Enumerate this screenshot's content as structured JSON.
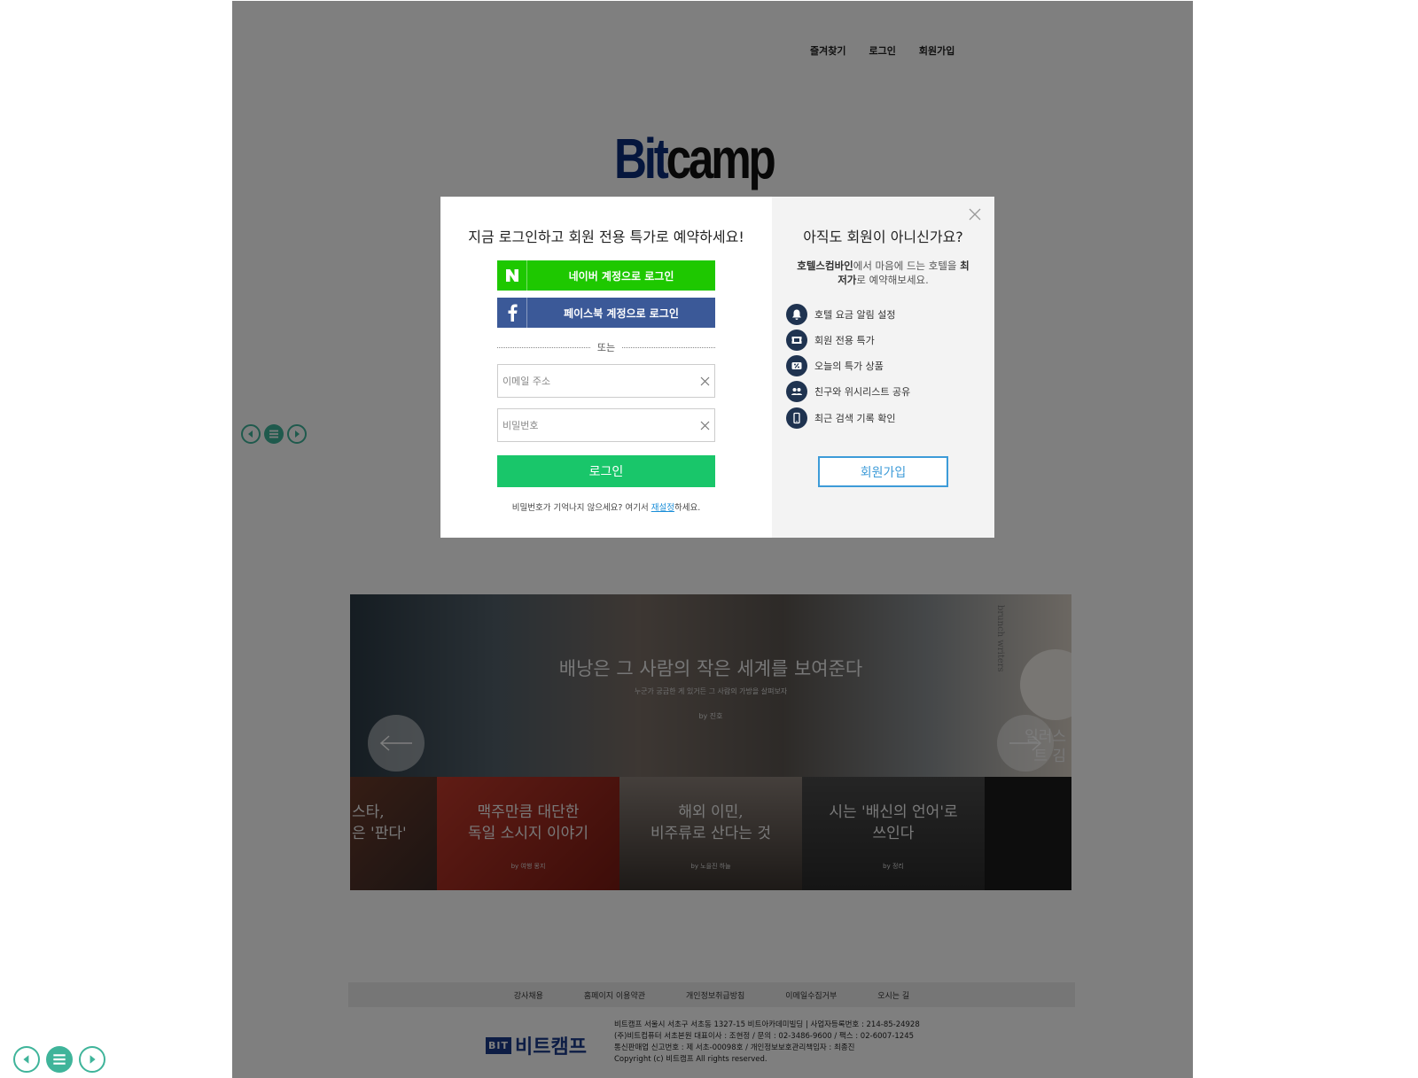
{
  "topnav": {
    "favorites": "즐겨찾기",
    "login": "로그인",
    "signup": "회원가입"
  },
  "logo": {
    "part1": "Bit",
    "part2": "camp"
  },
  "banner": {
    "headline": "배낭은 그 사람의 작은 세계를 보여준다",
    "subline": "누군가 궁금한 게 있거든 그 사람의 가방을 살펴보자",
    "byline": "by 진호",
    "side_text": "brunch writers",
    "right_peek_title": "일러스트 김",
    "tiles": [
      {
        "title": "스타,\n은 '판다'",
        "by": ""
      },
      {
        "title": "맥주만큼 대단한\n독일 소시지 이야기",
        "by": "by 여행 몽지"
      },
      {
        "title": "해외 이민,\n비주류로 산다는 것",
        "by": "by 노을진 하늘"
      },
      {
        "title": "시는 '배신의 언어'로\n쓰인다",
        "by": "by 정리"
      }
    ]
  },
  "footer": {
    "links": [
      "강사채용",
      "홈페이지 이용약관",
      "개인정보취급방침",
      "이메일수집거부",
      "오시는 길"
    ],
    "brand_mark": "BIT",
    "brand_name": "비트캠프",
    "info": [
      "비트캠프 서울시 서초구 서초동 1327-15 비트아카데미빌딩 | 사업자등록번호 : 214-85-24928",
      "(주)비트컴퓨터 서초본원 대표이사 : 조현정 / 문의 : 02-3486-9600 / 팩스 : 02-6007-1245",
      "통신판매업 신고번호 : 제 서초-00098호 / 개인정보보호관리책임자 : 최종진",
      "Copyright (c) 비트캠프 All rights reserved."
    ]
  },
  "modal": {
    "left_title": "지금 로그인하고 회원 전용 특가로 예약하세요!",
    "naver_label": "네이버 계정으로 로그인",
    "facebook_label": "페이스북 계정으로 로그인",
    "divider_text": "또는",
    "email_placeholder": "이메일 주소",
    "password_placeholder": "비밀번호",
    "login_button": "로그인",
    "forgot_prefix": "비밀번호가 기억나지 않으세요? 여기서 ",
    "forgot_link": "재설정",
    "forgot_suffix": "하세요.",
    "right_title": "아직도 회원이 아니신가요?",
    "right_desc": {
      "brand": "호텔스컴바인",
      "mid": "에서 마음에 드는 호텔을 ",
      "emph": "최저가",
      "end": "로 예약해보세요."
    },
    "benefits": [
      {
        "icon": "bell-icon",
        "label": "호텔 요금 알림 설정"
      },
      {
        "icon": "ticket-icon",
        "label": "회원 전용 특가"
      },
      {
        "icon": "percent-icon",
        "label": "오늘의 특가 상품"
      },
      {
        "icon": "friends-icon",
        "label": "친구와 위시리스트 공유"
      },
      {
        "icon": "phone-icon",
        "label": "최근 검색 기록 확인"
      }
    ],
    "signup_button": "회원가입"
  },
  "colors": {
    "naver": "#1ec800",
    "facebook": "#3b5998",
    "login_button": "#19c66a",
    "signup_border": "#3d9bd8",
    "benefit_icon_bg": "#1f3350",
    "control_teal": "#3fb49a"
  }
}
